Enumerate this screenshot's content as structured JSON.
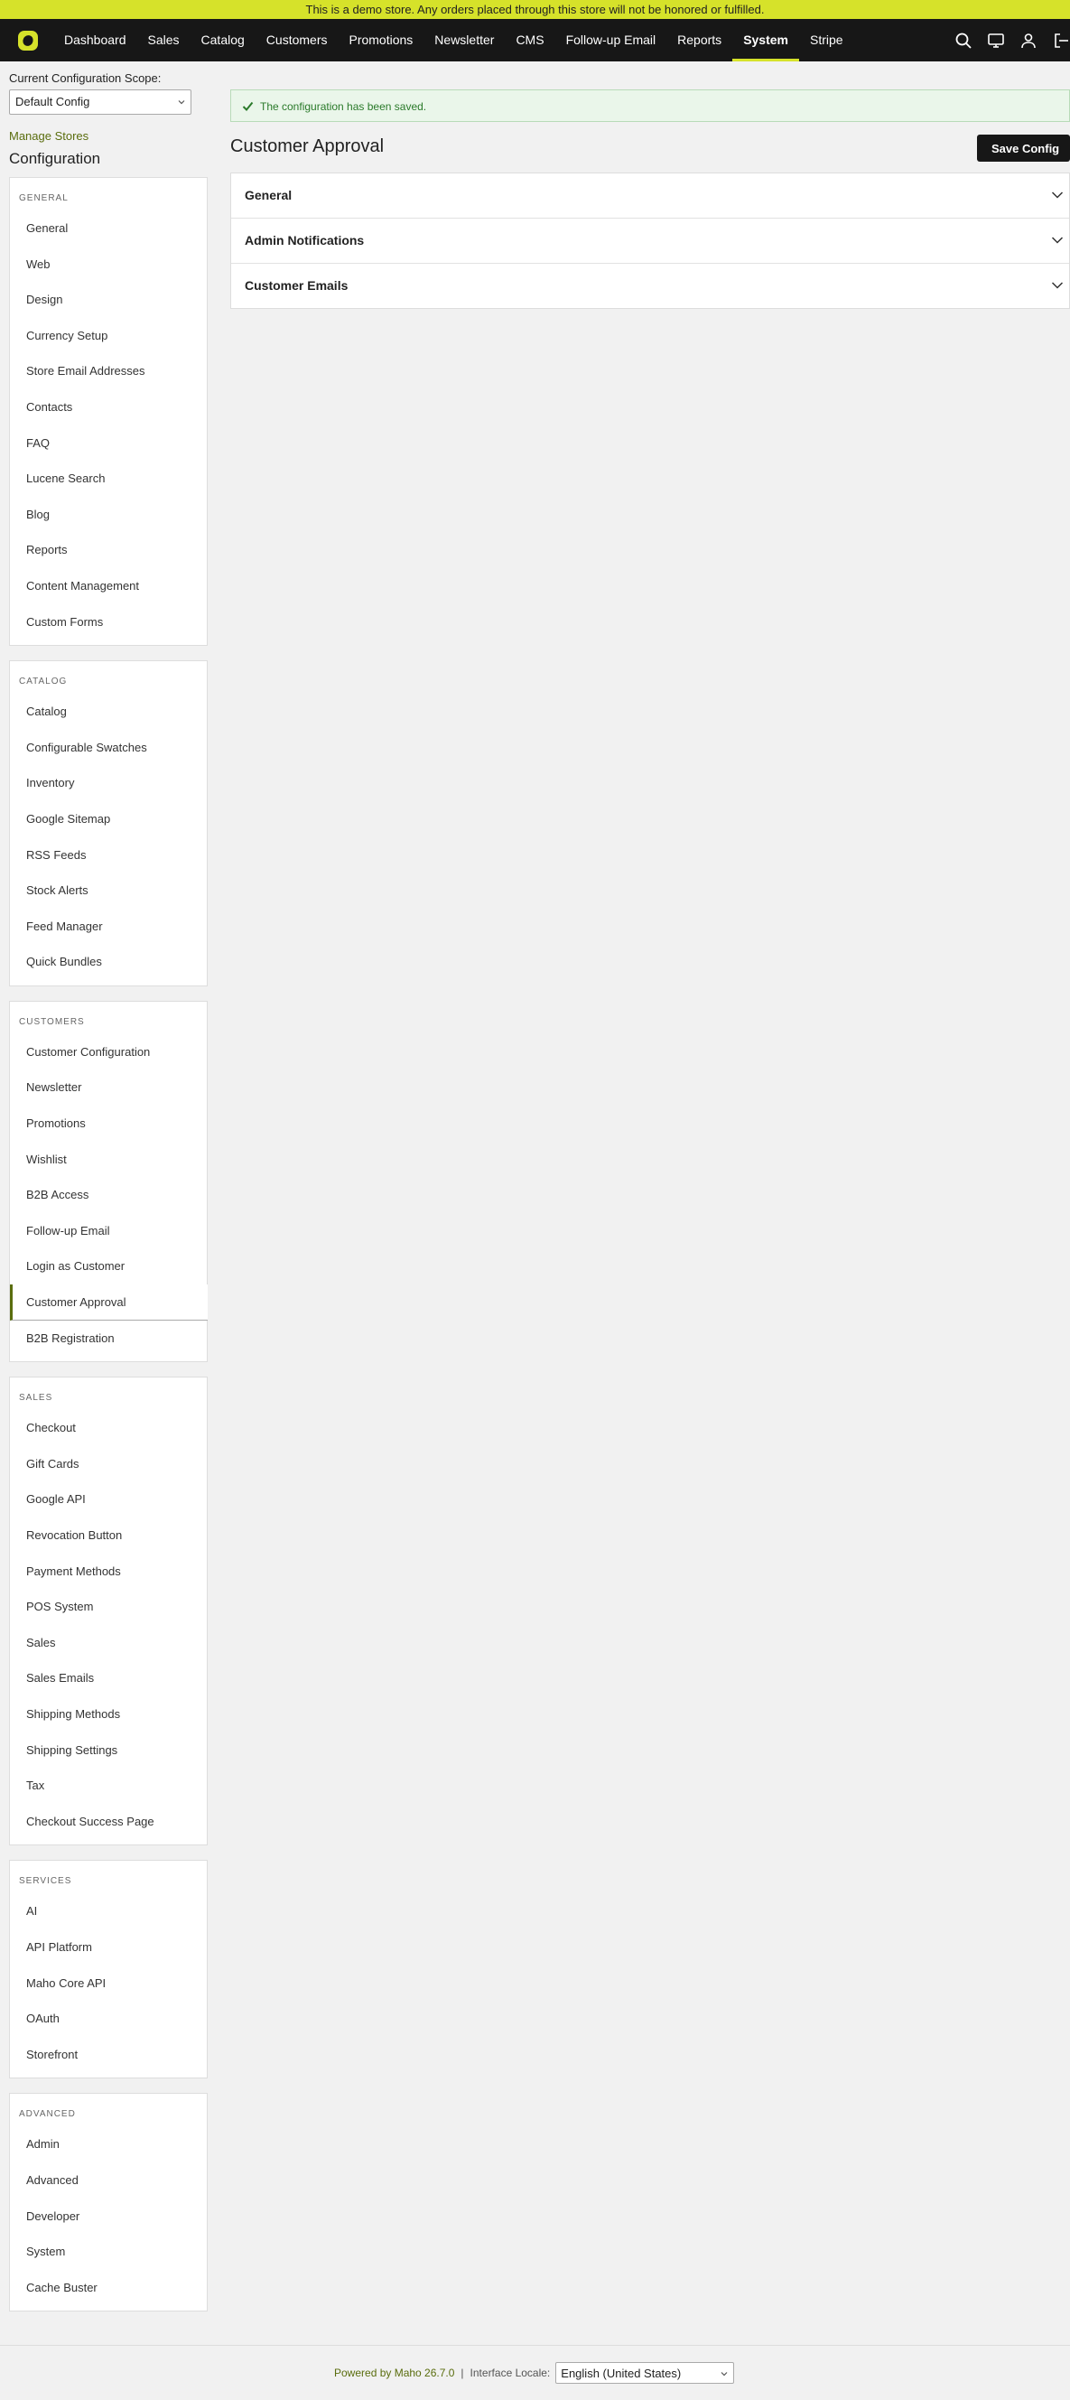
{
  "banner": "This is a demo store. Any orders placed through this store will not be honored or fulfilled.",
  "nav": {
    "items": [
      "Dashboard",
      "Sales",
      "Catalog",
      "Customers",
      "Promotions",
      "Newsletter",
      "CMS",
      "Follow-up Email",
      "Reports",
      "System",
      "Stripe"
    ],
    "active": "System",
    "icons": [
      "search-icon",
      "monitor-icon",
      "user-icon",
      "logout-icon"
    ]
  },
  "sidebar": {
    "scope_label": "Current Configuration Scope:",
    "scope_value": "Default Config",
    "manage_stores": "Manage Stores",
    "title": "Configuration",
    "groups": [
      {
        "head": "GENERAL",
        "items": [
          "General",
          "Web",
          "Design",
          "Currency Setup",
          "Store Email Addresses",
          "Contacts",
          "FAQ",
          "Lucene Search",
          "Blog",
          "Reports",
          "Content Management",
          "Custom Forms"
        ]
      },
      {
        "head": "CATALOG",
        "items": [
          "Catalog",
          "Configurable Swatches",
          "Inventory",
          "Google Sitemap",
          "RSS Feeds",
          "Stock Alerts",
          "Feed Manager",
          "Quick Bundles"
        ]
      },
      {
        "head": "CUSTOMERS",
        "items": [
          "Customer Configuration",
          "Newsletter",
          "Promotions",
          "Wishlist",
          "B2B Access",
          "Follow-up Email",
          "Login as Customer",
          "Customer Approval",
          "B2B Registration"
        ]
      },
      {
        "head": "SALES",
        "items": [
          "Checkout",
          "Gift Cards",
          "Google API",
          "Revocation Button",
          "Payment Methods",
          "POS System",
          "Sales",
          "Sales Emails",
          "Shipping Methods",
          "Shipping Settings",
          "Tax",
          "Checkout Success Page"
        ]
      },
      {
        "head": "SERVICES",
        "items": [
          "AI",
          "API Platform",
          "Maho Core API",
          "OAuth",
          "Storefront"
        ]
      },
      {
        "head": "ADVANCED",
        "items": [
          "Admin",
          "Advanced",
          "Developer",
          "System",
          "Cache Buster"
        ]
      }
    ],
    "active_item": "Customer Approval"
  },
  "main": {
    "success": "The configuration has been saved.",
    "title": "Customer Approval",
    "save_label": "Save Config",
    "sections": [
      "General",
      "Admin Notifications",
      "Customer Emails"
    ]
  },
  "footer": {
    "powered": "Powered by Maho 26.7.0",
    "separator": "|",
    "locale_label": "Interface Locale:",
    "locale_value": "English (United States)"
  },
  "colors": {
    "accent": "#d6e22a",
    "nav_bg": "#171717",
    "link": "#5a6d0e",
    "success": "#2a7a2a"
  }
}
